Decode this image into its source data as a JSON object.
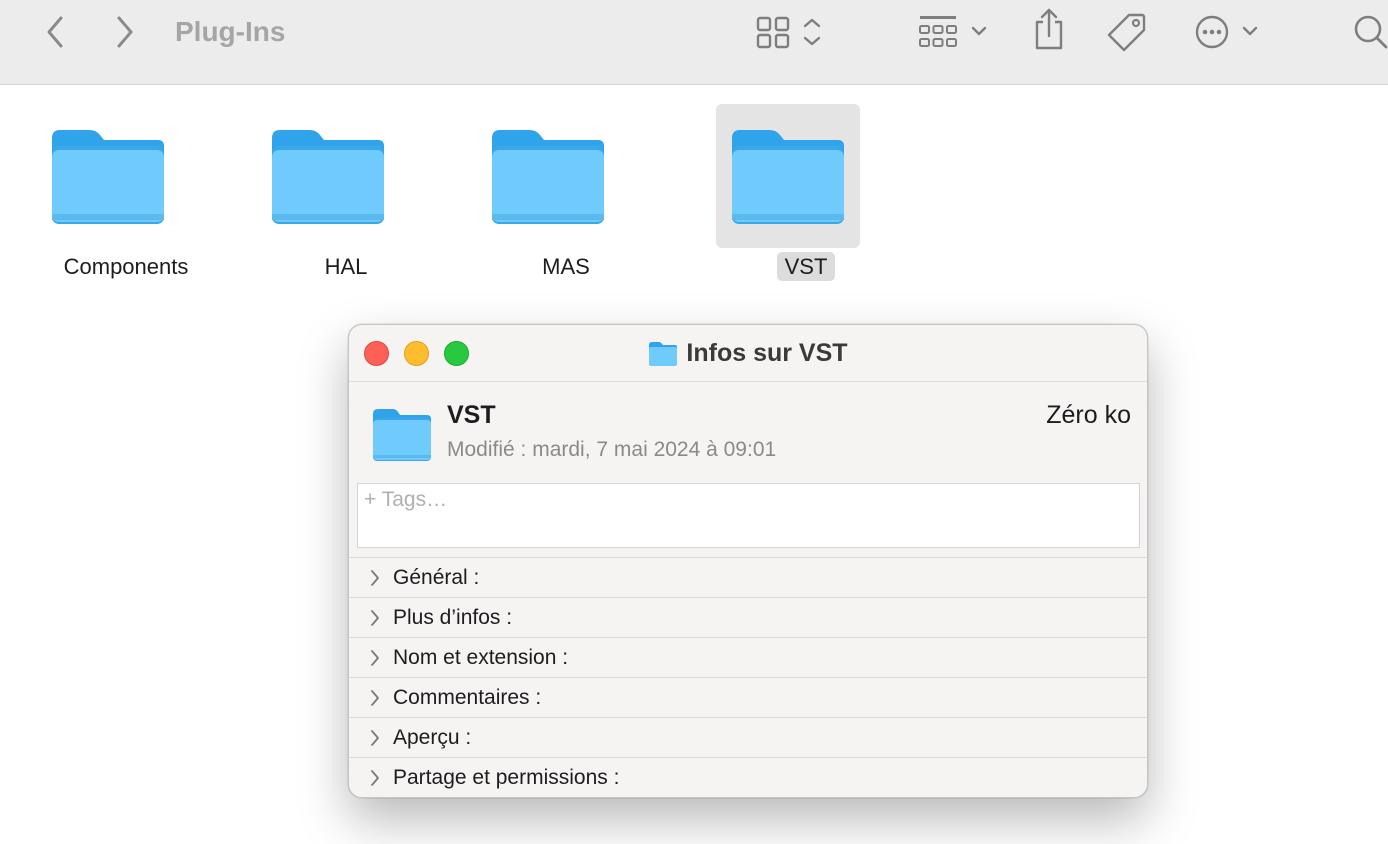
{
  "toolbar": {
    "title": "Plug-Ins",
    "icons": [
      "chevron-left-icon",
      "chevron-right-icon",
      "grid-view-icon",
      "group-icon",
      "share-icon",
      "tag-icon",
      "more-icon",
      "search-icon"
    ]
  },
  "folders": [
    {
      "name": "Components",
      "selected": false
    },
    {
      "name": "HAL",
      "selected": false
    },
    {
      "name": "MAS",
      "selected": false
    },
    {
      "name": "VST",
      "selected": true
    }
  ],
  "info": {
    "title": "Infos sur VST",
    "name": "VST",
    "size": "Zéro ko",
    "modified": "Modifié : mardi, 7 mai 2024 à 09:01",
    "tags_placeholder": "+ Tags…",
    "sections": [
      "Général :",
      "Plus d’infos :",
      "Nom et extension :",
      "Commentaires :",
      "Aperçu :",
      "Partage et permissions :"
    ]
  },
  "colors": {
    "folder_light": "#6fcbfb",
    "folder_dark": "#2fa4ea",
    "close": "#fe5f57",
    "minimize": "#febc2e",
    "zoom": "#28c840"
  }
}
